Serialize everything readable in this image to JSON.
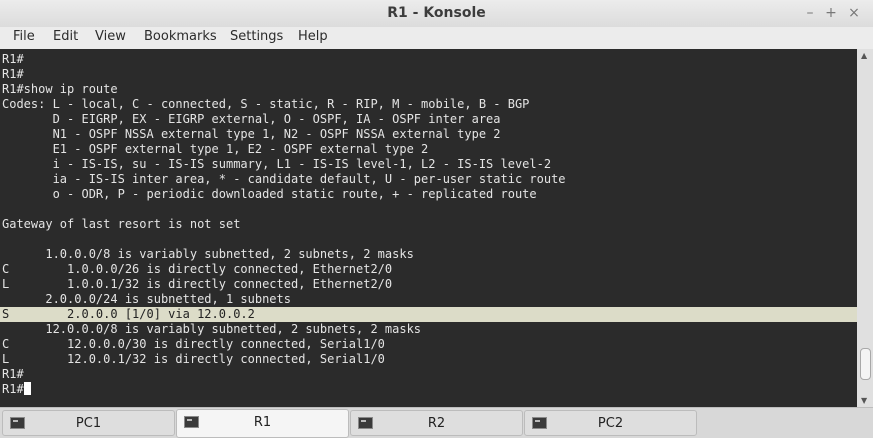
{
  "window": {
    "title": "R1 - Konsole"
  },
  "window_controls": {
    "minimize": "–",
    "maximize": "+",
    "close": "×"
  },
  "menu": [
    "File",
    "Edit",
    "View",
    "Bookmarks",
    "Settings",
    "Help"
  ],
  "terminal": {
    "lines": [
      "R1#",
      "R1#",
      "R1#show ip route",
      "Codes: L - local, C - connected, S - static, R - RIP, M - mobile, B - BGP",
      "       D - EIGRP, EX - EIGRP external, O - OSPF, IA - OSPF inter area",
      "       N1 - OSPF NSSA external type 1, N2 - OSPF NSSA external type 2",
      "       E1 - OSPF external type 1, E2 - OSPF external type 2",
      "       i - IS-IS, su - IS-IS summary, L1 - IS-IS level-1, L2 - IS-IS level-2",
      "       ia - IS-IS inter area, * - candidate default, U - per-user static route",
      "       o - ODR, P - periodic downloaded static route, + - replicated route",
      "",
      "Gateway of last resort is not set",
      "",
      "      1.0.0.0/8 is variably subnetted, 2 subnets, 2 masks",
      "C        1.0.0.0/26 is directly connected, Ethernet2/0",
      "L        1.0.0.1/32 is directly connected, Ethernet2/0",
      "      2.0.0.0/24 is subnetted, 1 subnets",
      "S        2.0.0.0 [1/0] via 12.0.0.2",
      "      12.0.0.0/8 is variably subnetted, 2 subnets, 2 masks",
      "C        12.0.0.0/30 is directly connected, Serial1/0",
      "L        12.0.0.1/32 is directly connected, Serial1/0",
      "R1#",
      "R1#"
    ],
    "highlighted_line_index": 17
  },
  "scrollbar": {
    "up_arrow": "▲",
    "down_arrow": "▼"
  },
  "tabs": [
    {
      "label": "PC1",
      "active": false
    },
    {
      "label": "R1",
      "active": true
    },
    {
      "label": "R2",
      "active": false
    },
    {
      "label": "PC2",
      "active": false
    }
  ]
}
